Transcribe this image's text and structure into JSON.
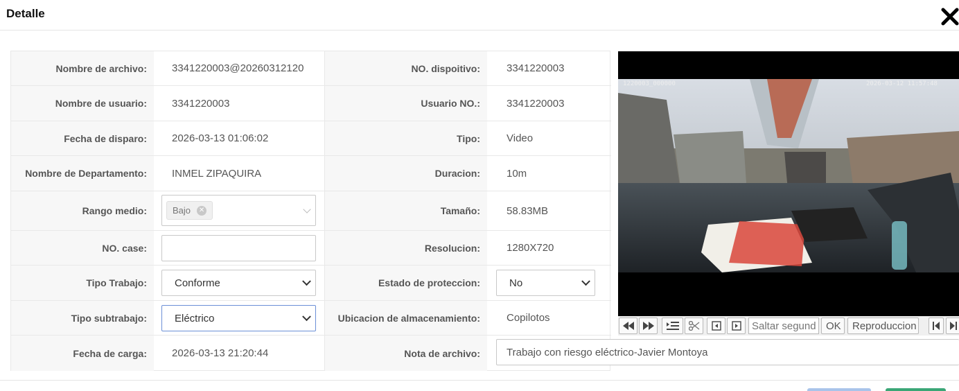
{
  "dialog": {
    "title": "Detalle"
  },
  "icons": {
    "close": "close-icon"
  },
  "fields": {
    "nombre_archivo": {
      "label": "Nombre de archivo:",
      "value": "3341220003@20260312120"
    },
    "no_dispositivo": {
      "label": "NO. dispoitivo:",
      "value": "3341220003"
    },
    "nombre_usuario": {
      "label": "Nombre de usuario:",
      "value": "3341220003"
    },
    "usuario_no": {
      "label": "Usuario NO.:",
      "value": "3341220003"
    },
    "fecha_disparo": {
      "label": "Fecha de disparo:",
      "value": "2026-03-13 01:06:02"
    },
    "tipo": {
      "label": "Tipo:",
      "value": "Video"
    },
    "departamento": {
      "label": "Nombre de Departamento:",
      "value": "INMEL ZIPAQUIRA"
    },
    "duracion": {
      "label": "Duracion:",
      "value": "10m"
    },
    "rango_medio": {
      "label": "Rango medio:",
      "tag": "Bajo"
    },
    "tamano": {
      "label": "Tamaño:",
      "value": "58.83MB"
    },
    "no_case": {
      "label": "NO. case:",
      "value": ""
    },
    "resolucion": {
      "label": "Resolucion:",
      "value": "1280X720"
    },
    "tipo_trabajo": {
      "label": "Tipo Trabajo:",
      "value": "Conforme"
    },
    "estado_proteccion": {
      "label": "Estado de proteccion:",
      "value": "No"
    },
    "tipo_subtrabajo": {
      "label": "Tipo subtrabajo:",
      "value": "Eléctrico"
    },
    "ubicacion": {
      "label": "Ubicacion de almacenamiento:",
      "value": "Copilotos"
    },
    "fecha_carga": {
      "label": "Fecha de carga:",
      "value": "2026-03-13 21:20:44"
    },
    "nota_archivo": {
      "label": "Nota de archivo:",
      "value": "Trabajo con riesgo eléctrico-Javier Montoya"
    }
  },
  "video": {
    "osd_left": "1220003_000000",
    "osd_right": "2026-03-12  11:57:48"
  },
  "player": {
    "seek_placeholder": "Saltar segundo",
    "ok_label": "OK",
    "play_label": "Reproduccion"
  },
  "colors": {
    "accent_blue": "#6b8fd6",
    "footer_green": "#3aa676",
    "footer_blue": "#a9c4ea"
  }
}
